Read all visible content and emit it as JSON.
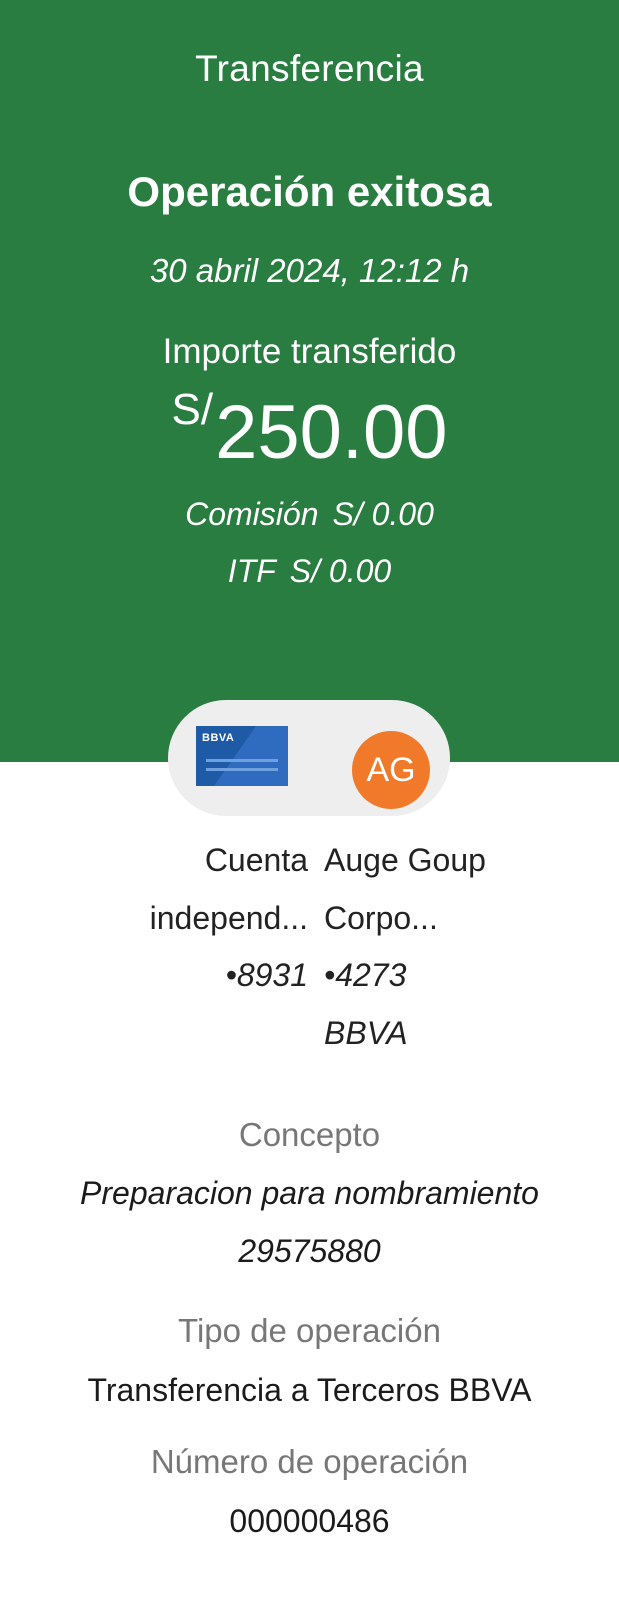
{
  "header": {
    "title": "Transferencia",
    "status": "Operación exitosa",
    "datetime": "30 abril 2024, 12:12 h",
    "amount_label": "Importe transferido",
    "currency": "S/",
    "amount": "250.00",
    "commission_label": "Comisión",
    "commission_value": "S/ 0.00",
    "itf_label": "ITF",
    "itf_value": "S/ 0.00",
    "background_color": "#2a7d41"
  },
  "transfer": {
    "from": {
      "bank_logo_text": "BBVA",
      "name_line1": "Cuenta",
      "name_line2": "independ...",
      "number": "•8931",
      "icon": "bbva-card-icon"
    },
    "to": {
      "initials": "AG",
      "name_line1": "Auge Goup",
      "name_line2": "Corpo...",
      "number": "•4273",
      "bank": "BBVA",
      "avatar_color": "#f07a2a"
    }
  },
  "details": {
    "concept_label": "Concepto",
    "concept_value_line1": "Preparacion para nombramiento",
    "concept_value_line2": "29575880",
    "type_label": "Tipo de operación",
    "type_value": "Transferencia a Terceros BBVA",
    "number_label": "Número de operación",
    "number_value": "000000486"
  }
}
